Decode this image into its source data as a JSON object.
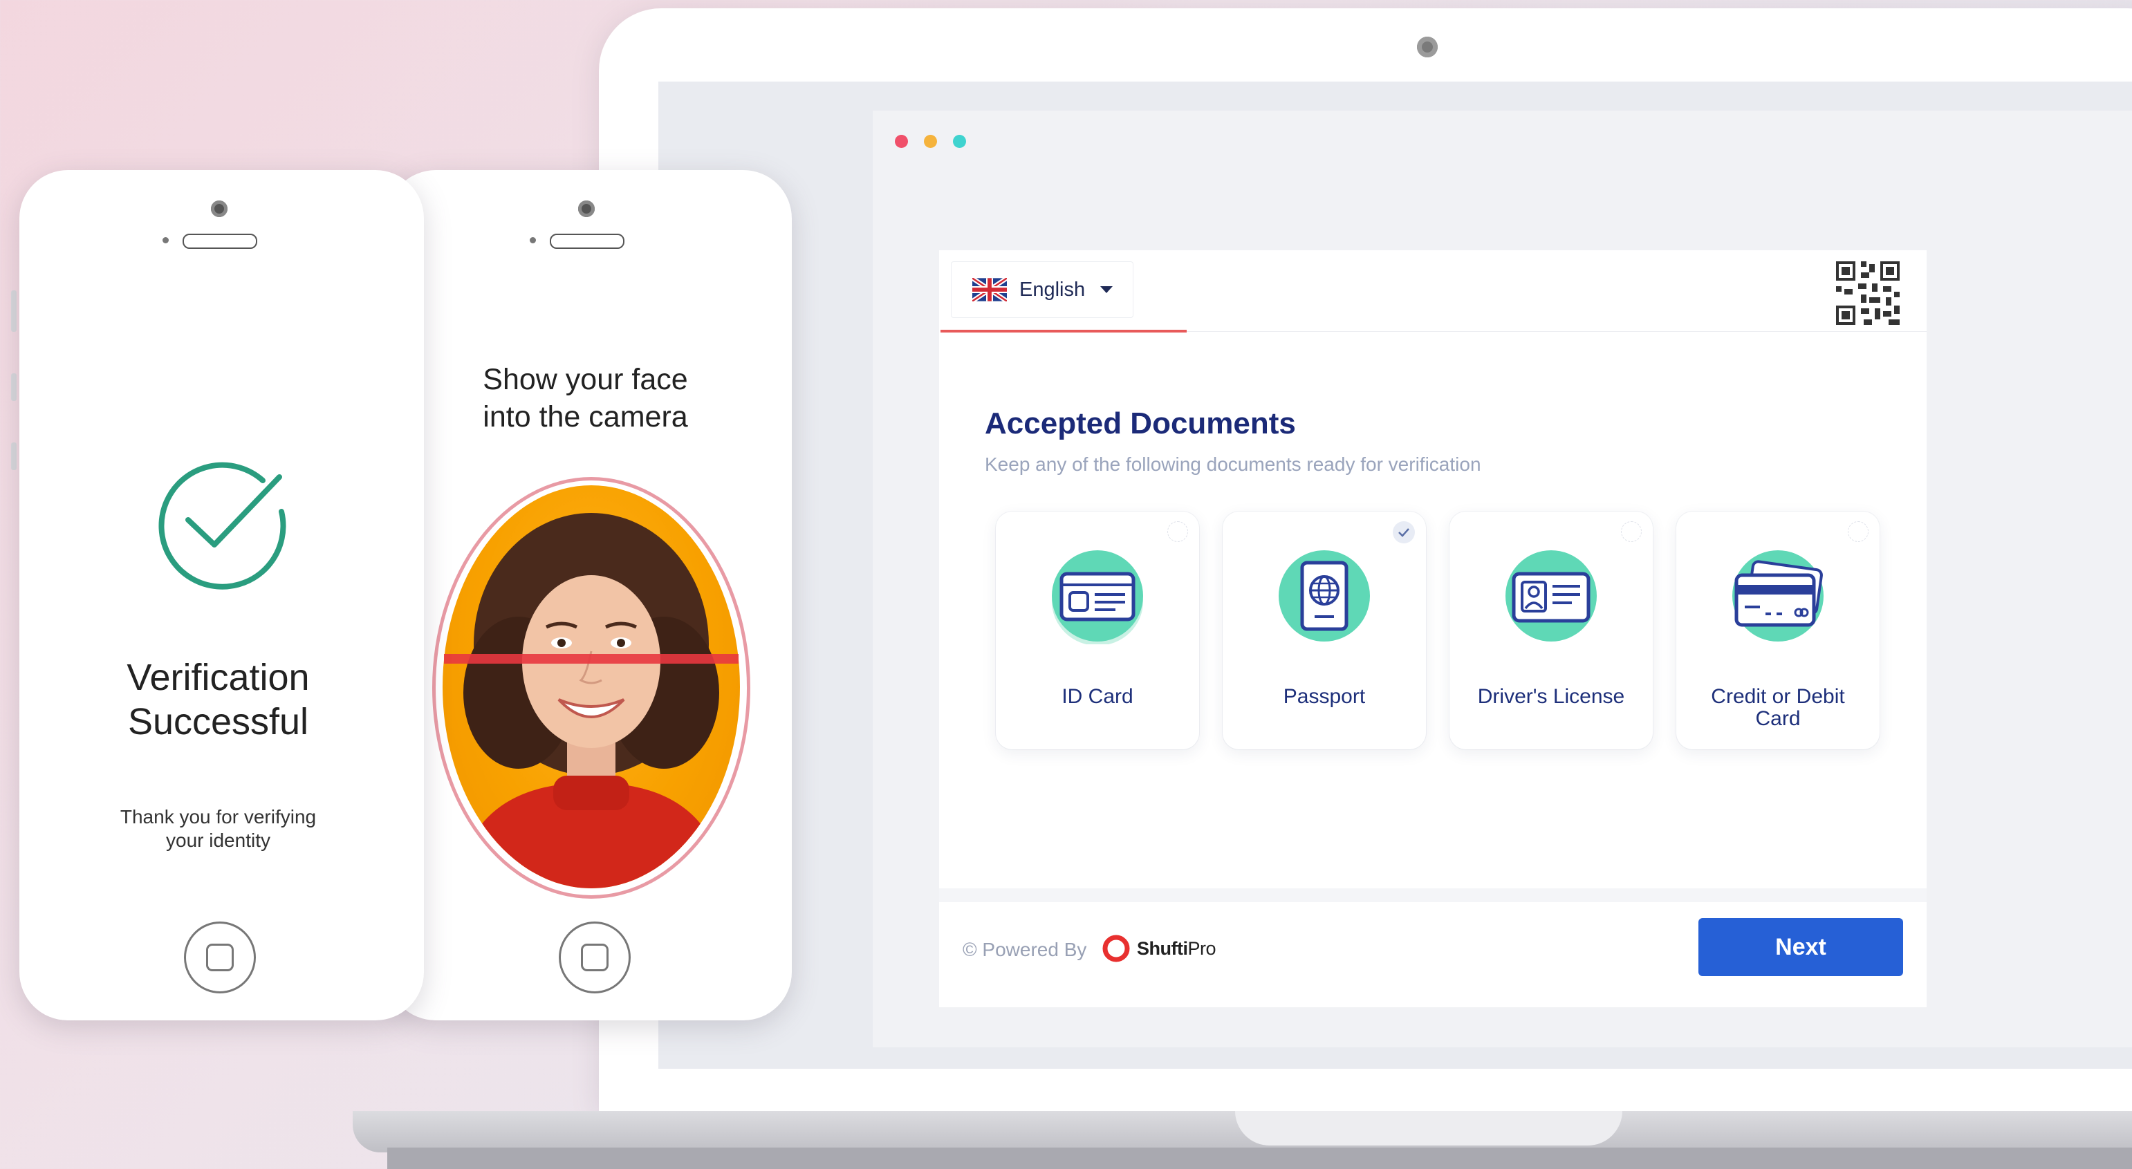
{
  "laptop": {
    "browser_dots": [
      "#f0506a",
      "#f5b33c",
      "#3fd3cf"
    ],
    "language": {
      "label": "English",
      "flag": "uk-flag-icon"
    },
    "qr_icon": "qr-code-icon",
    "accepted_documents": {
      "title": "Accepted Documents",
      "subtitle": "Keep any of the following documents ready for verification",
      "items": [
        {
          "label": "ID Card",
          "icon": "id-card-icon",
          "selected": false
        },
        {
          "label": "Passport",
          "icon": "passport-icon",
          "selected": true
        },
        {
          "label": "Driver's License",
          "icon": "drivers-license-icon",
          "selected": false
        },
        {
          "label": "Credit or Debit Card",
          "icon": "credit-card-icon",
          "selected": false
        }
      ]
    },
    "footer": {
      "powered_by": "© Powered By",
      "brand_bold": "Shufti",
      "brand_light": "Pro",
      "next_label": "Next"
    }
  },
  "phone_success": {
    "icon": "check-circle-icon",
    "title_line1": "Verification",
    "title_line2": "Successful",
    "subtitle_line1": "Thank you for verifying",
    "subtitle_line2": "your identity"
  },
  "phone_face": {
    "title_line1": "Show your face",
    "title_line2": "into the camera"
  },
  "colors": {
    "accent_blue": "#2660d6",
    "title_navy": "#1b2a78",
    "tab_underline": "#e85a5a",
    "icon_teal": "#5fd8b6",
    "success_green": "#2a9d7f"
  }
}
